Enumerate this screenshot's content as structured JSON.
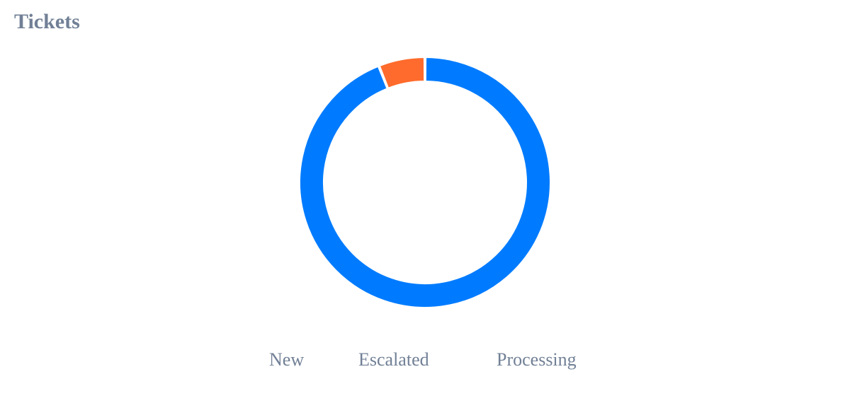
{
  "title": "Tickets",
  "chart_data": {
    "type": "pie",
    "style": "donut",
    "categories": [
      "New",
      "Escalated",
      "Processing"
    ],
    "values": [
      0,
      6,
      94
    ],
    "colors": [
      "#ff6b2c",
      "#ff6b2c",
      "#007bff"
    ],
    "legend": "bottom"
  }
}
